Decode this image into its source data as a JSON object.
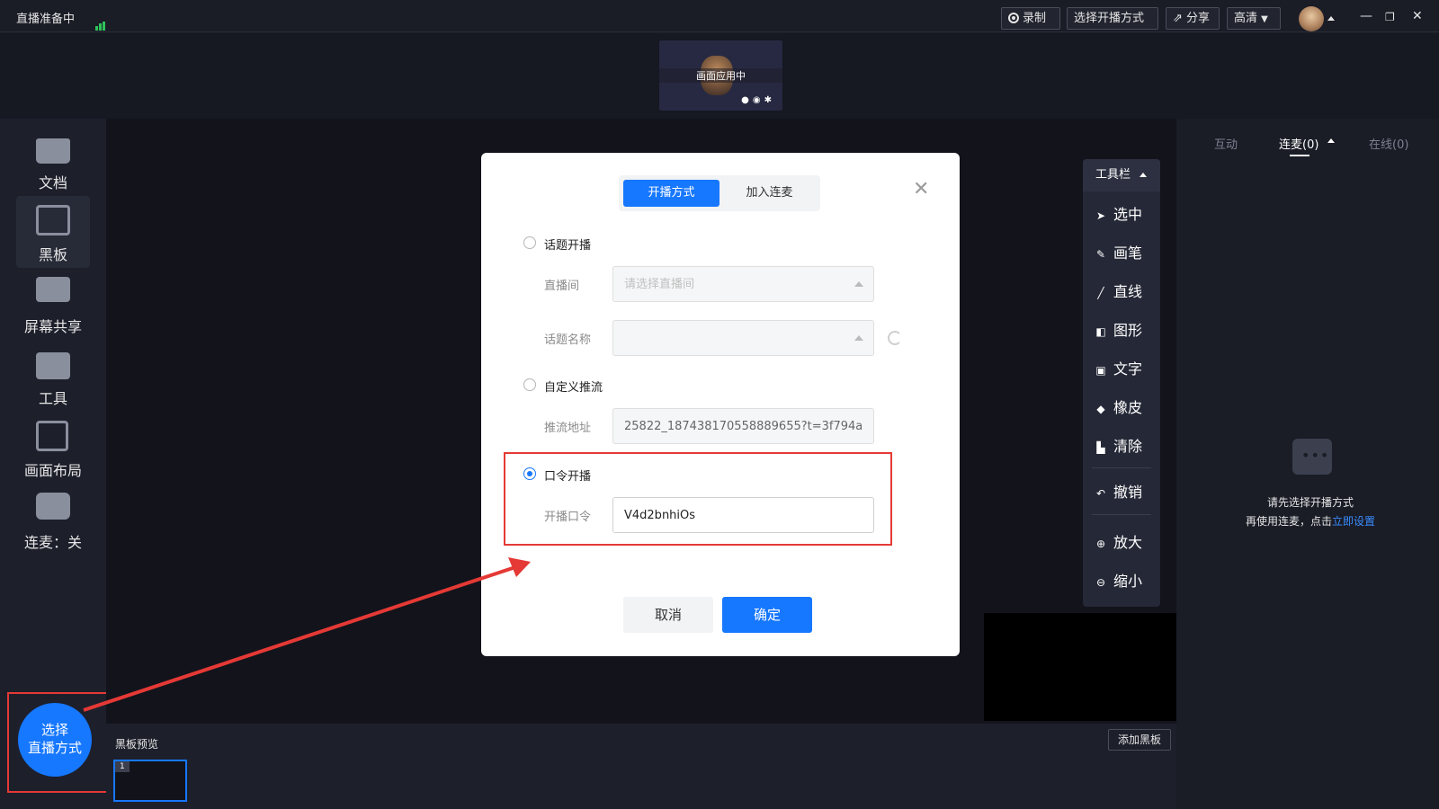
{
  "topbar": {
    "status": "直播准备中",
    "record_label": "录制",
    "select_mode_label": "选择开播方式",
    "share_label": "分享",
    "quality_label": "高清",
    "minimize": "—",
    "restore": "❐",
    "close": "✕"
  },
  "preview": {
    "label": "画面应用中"
  },
  "sidebar": {
    "items": [
      {
        "label": "文档",
        "icon": "folder-icon"
      },
      {
        "label": "黑板",
        "icon": "blackboard-icon"
      },
      {
        "label": "屏幕共享",
        "icon": "screen-share-icon"
      },
      {
        "label": "工具",
        "icon": "toolbox-icon"
      },
      {
        "label": "画面布局",
        "icon": "layout-icon"
      },
      {
        "label": "连麦：关",
        "icon": "chat-bubbles-icon"
      }
    ],
    "go_live_line1": "选择",
    "go_live_line2": "直播方式"
  },
  "bottom": {
    "board_preview_label": "黑板预览",
    "add_board_label": "添加黑板",
    "thumbnail_number": "1"
  },
  "right_panel": {
    "tabs": [
      "互动",
      "连麦(0)",
      "在线(0)"
    ],
    "message_line1": "请先选择开播方式",
    "message_line2": "再使用连麦，点击",
    "message_link": "立即设置"
  },
  "toolbar": {
    "title": "工具栏",
    "items": [
      {
        "label": "选中",
        "icon": "cursor-icon"
      },
      {
        "label": "画笔",
        "icon": "pen-icon"
      },
      {
        "label": "直线",
        "icon": "line-icon"
      },
      {
        "label": "图形",
        "icon": "shape-icon"
      },
      {
        "label": "文字",
        "icon": "text-icon"
      },
      {
        "label": "橡皮",
        "icon": "eraser-icon"
      },
      {
        "label": "清除",
        "icon": "clear-icon"
      },
      {
        "label": "撤销",
        "icon": "undo-icon"
      },
      {
        "label": "放大",
        "icon": "zoom-in-icon"
      },
      {
        "label": "缩小",
        "icon": "zoom-out-icon"
      }
    ]
  },
  "modal": {
    "tab_active": "开播方式",
    "tab_other": "加入连麦",
    "option_topic": "话题开播",
    "room_label": "直播间",
    "room_placeholder": "请选择直播间",
    "topic_name_label": "话题名称",
    "option_custom": "自定义推流",
    "push_url_label": "推流地址",
    "push_url_value": "25822_187438170558889655?t=3f794a",
    "option_password": "口令开播",
    "password_label": "开播口令",
    "password_value": "V4d2bnhiOs",
    "cancel_label": "取消",
    "ok_label": "确定"
  },
  "colors": {
    "accent": "#1677ff",
    "highlight": "#e53935"
  }
}
